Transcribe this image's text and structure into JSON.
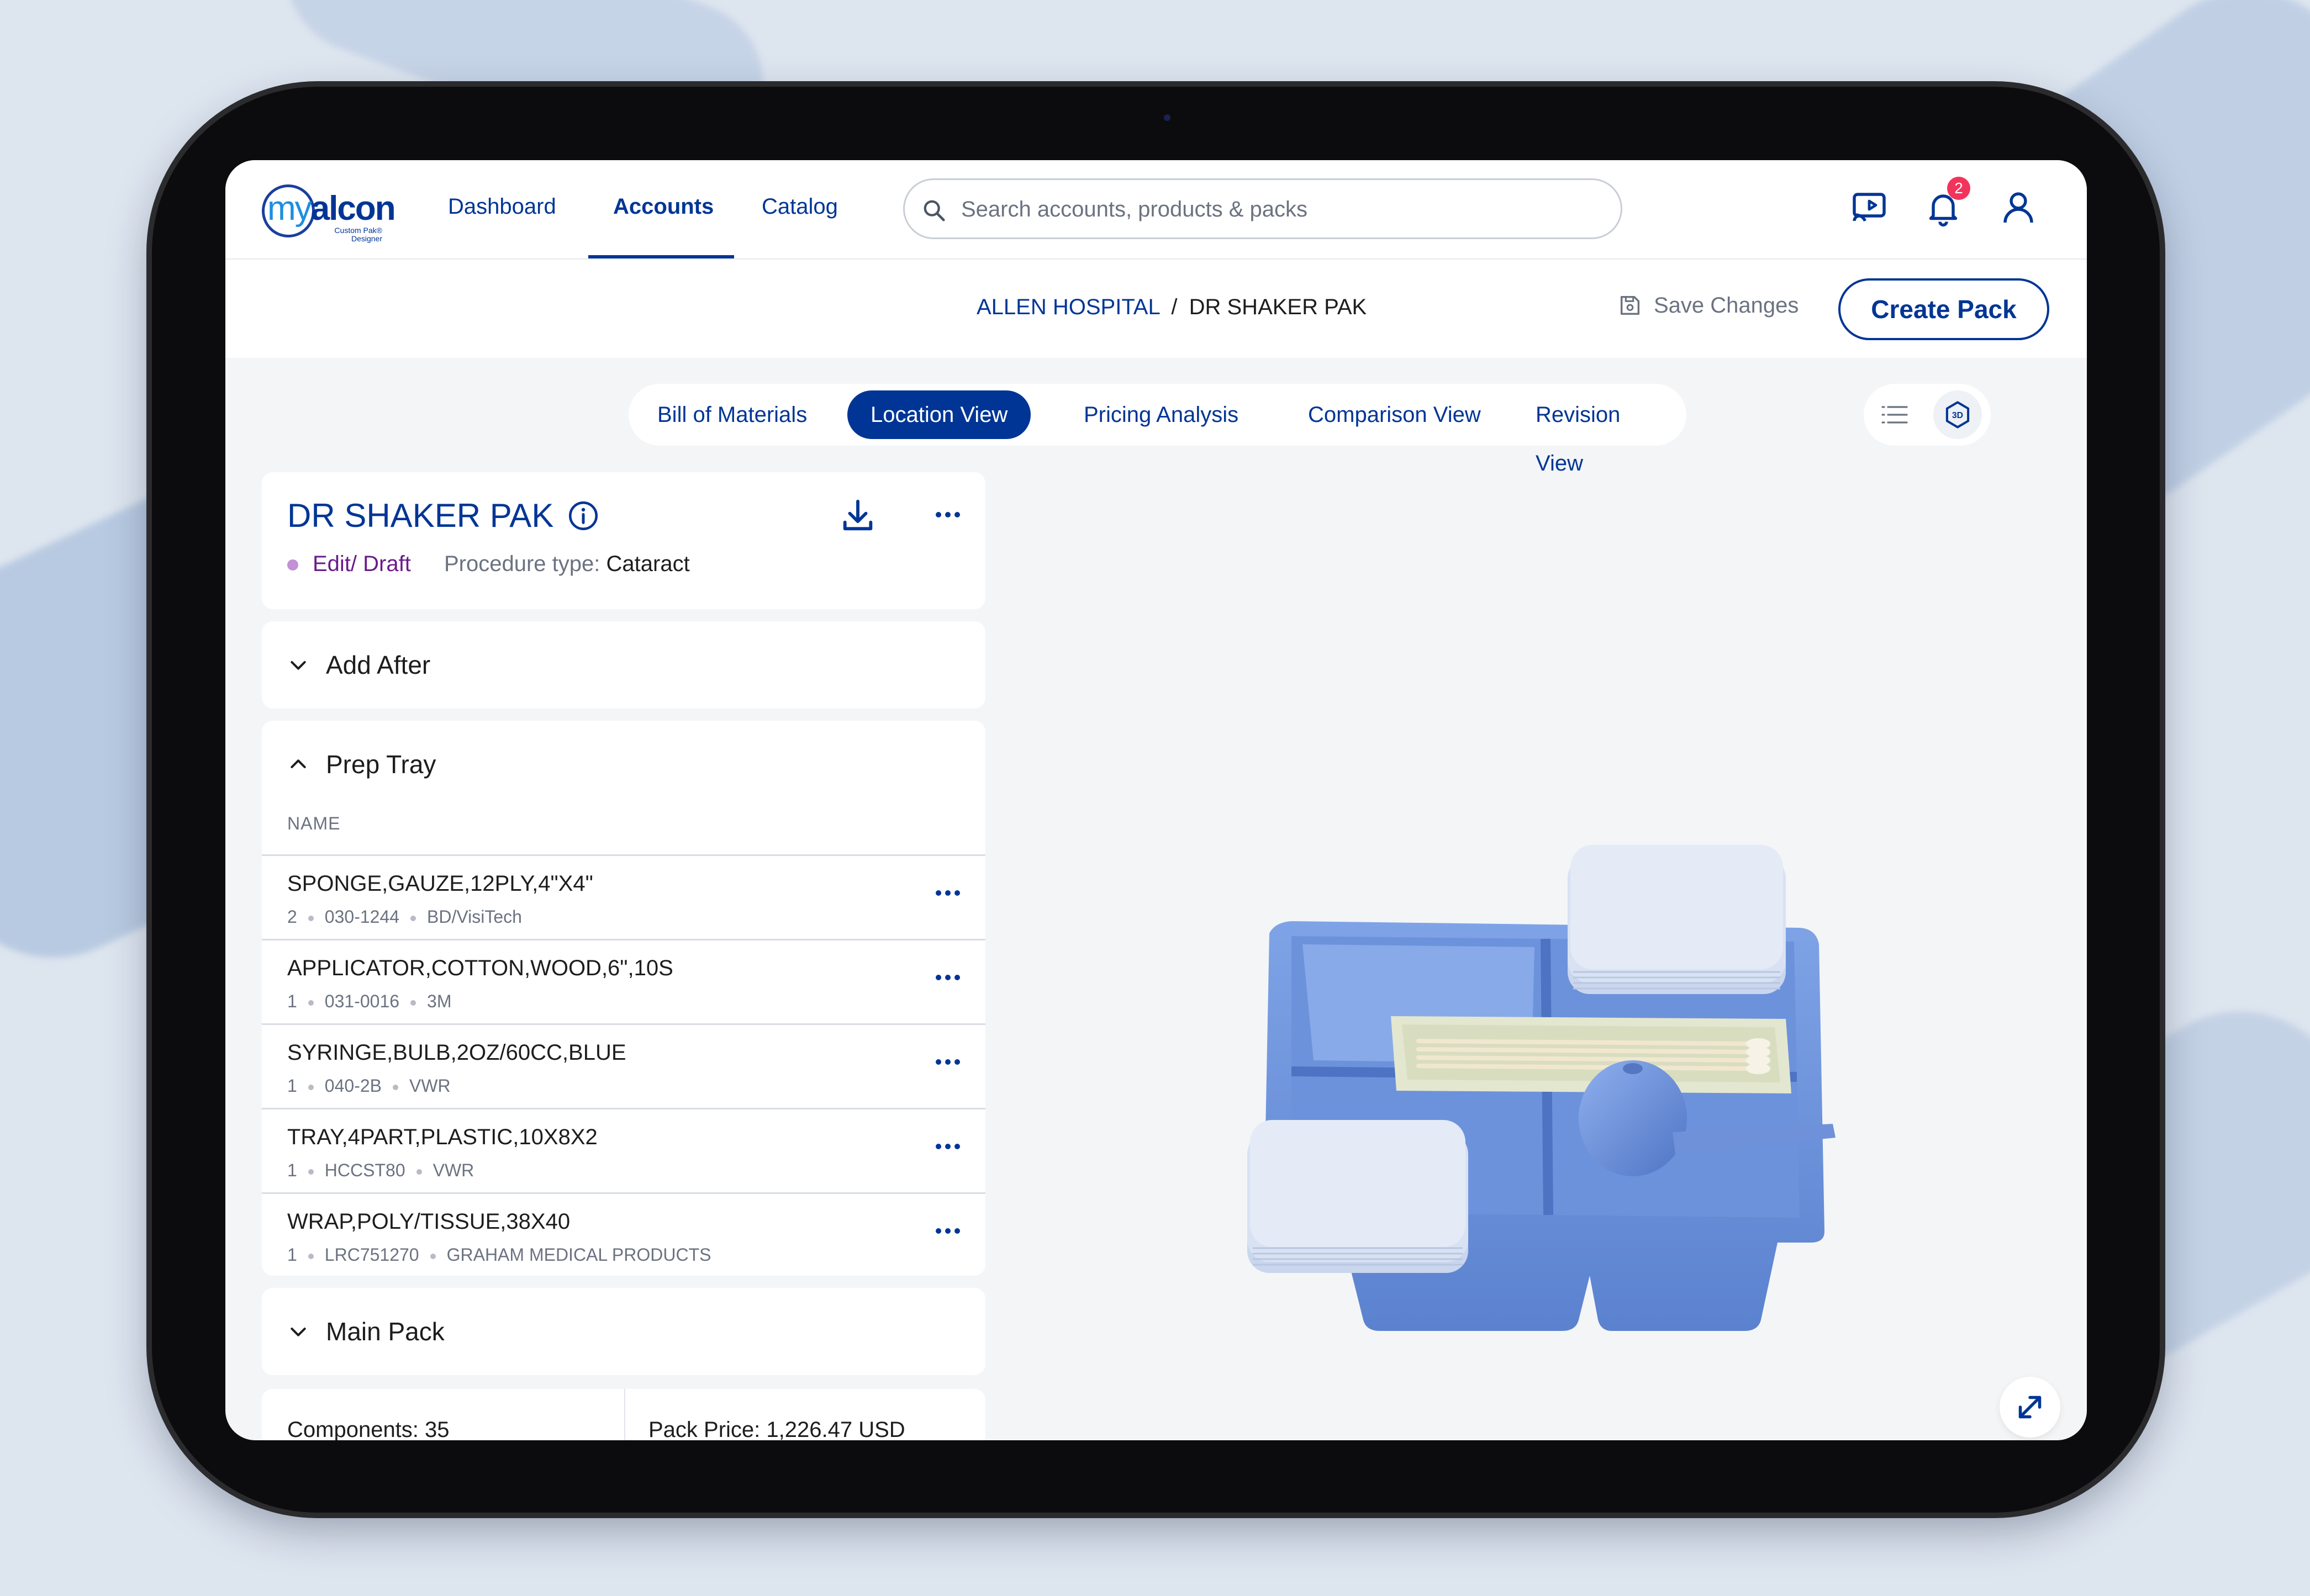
{
  "logo": {
    "brand_my": "my",
    "brand_alcon": "alcon",
    "tagline_line1": "Custom Pak®",
    "tagline_line2": "Designer"
  },
  "nav": {
    "items": [
      "Dashboard",
      "Accounts",
      "Catalog"
    ],
    "active": "Accounts"
  },
  "search": {
    "placeholder": "Search accounts, products & packs"
  },
  "header_icons": {
    "cast": "cast-icon",
    "notifications": "bell-icon",
    "notification_count": "2",
    "profile": "user-icon"
  },
  "breadcrumb": {
    "account": "ALLEN HOSPITAL",
    "separator": "/",
    "pack": "DR SHAKER PAK"
  },
  "actions": {
    "save_label": "Save Changes",
    "create_label": "Create Pack"
  },
  "tabs": [
    "Bill of Materials",
    "Location View",
    "Pricing Analysis",
    "Comparison View",
    "Revision View"
  ],
  "active_tab": "Location View",
  "view_toggle": {
    "list": "list-icon",
    "three_d": "3D"
  },
  "pack": {
    "title": "DR SHAKER PAK",
    "status": "Edit/ Draft",
    "procedure_label": "Procedure type:",
    "procedure_value": "Cataract"
  },
  "sections": {
    "add_after": "Add After",
    "prep_tray": "Prep Tray",
    "main_pack": "Main Pack"
  },
  "table": {
    "column": "NAME",
    "rows": [
      {
        "name": "SPONGE,GAUZE,12PLY,4\"X4\"",
        "qty": "2",
        "code": "030-1244",
        "vendor": "BD/VisiTech"
      },
      {
        "name": "APPLICATOR,COTTON,WOOD,6\",10S",
        "qty": "1",
        "code": "031-0016",
        "vendor": "3M"
      },
      {
        "name": "SYRINGE,BULB,2OZ/60CC,BLUE",
        "qty": "1",
        "code": "040-2B",
        "vendor": "VWR"
      },
      {
        "name": "TRAY,4PART,PLASTIC,10X8X2",
        "qty": "1",
        "code": "HCCST80",
        "vendor": "VWR"
      },
      {
        "name": "WRAP,POLY/TISSUE,38X40",
        "qty": "1",
        "code": "LRC751270",
        "vendor": "GRAHAM MEDICAL PRODUCTS"
      }
    ]
  },
  "summary": {
    "components": "Components: 35",
    "price": "Pack Price: 1,226.47 USD"
  },
  "colors": {
    "primary": "#003595",
    "accent": "#1d8fe0",
    "badge": "#f2335b",
    "tray": "#6b92dd",
    "status_dot": "#c291d6"
  }
}
